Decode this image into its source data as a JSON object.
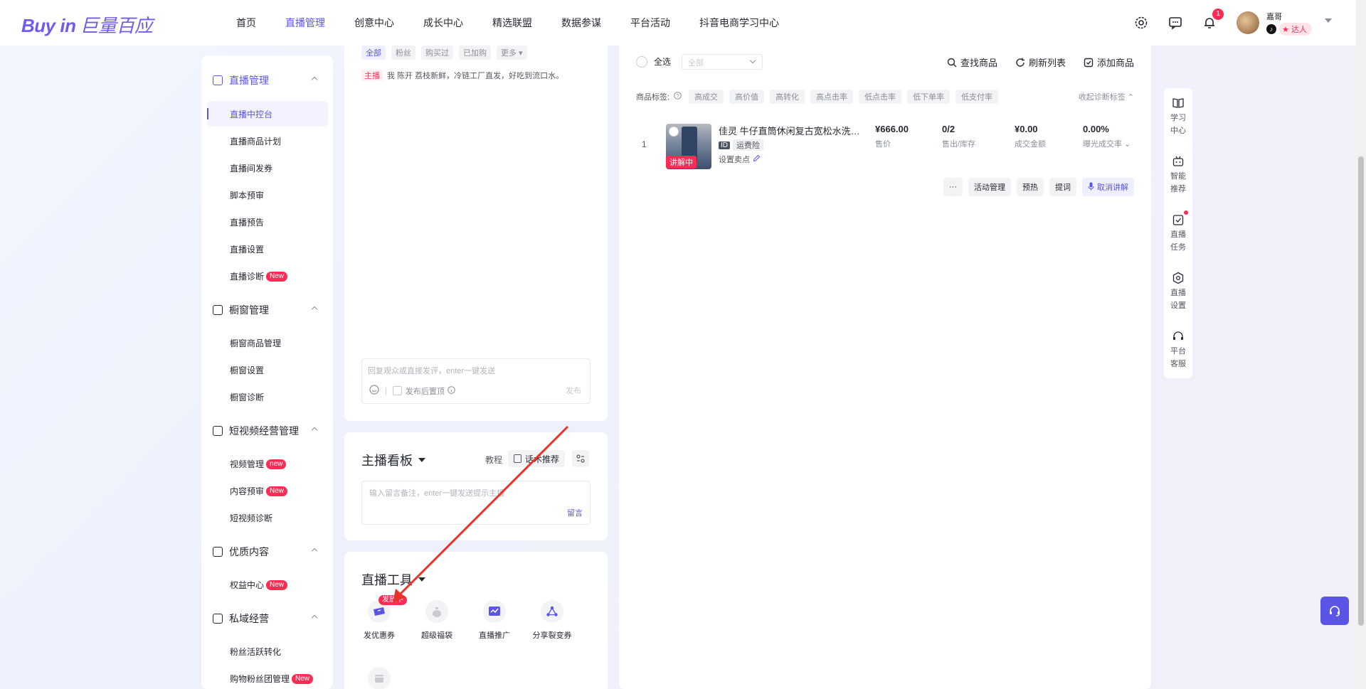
{
  "header": {
    "logo_en": "Buy in",
    "logo_cn": "巨量百应",
    "nav": [
      "首页",
      "直播管理",
      "创意中心",
      "成长中心",
      "精选联盟",
      "数据参谋",
      "平台活动",
      "抖音电商学习中心"
    ],
    "active_nav": "直播管理",
    "notification_count": "1",
    "user_name": "嘉哥",
    "user_tag": "达人",
    "douyin_glyph": "♪",
    "talent_glyph": "★"
  },
  "sidebar": {
    "groups": [
      {
        "label": "直播管理",
        "items": [
          "直播中控台",
          "直播商品计划",
          "直播间发券",
          "脚本预审",
          "直播预告",
          "直播设置",
          "直播诊断"
        ]
      },
      {
        "label": "橱窗管理",
        "items": [
          "橱窗商品管理",
          "橱窗设置",
          "橱窗诊断"
        ]
      },
      {
        "label": "短视频经营管理",
        "items": [
          "视频管理",
          "内容预审",
          "短视频诊断"
        ]
      },
      {
        "label": "优质内容",
        "items": [
          "权益中心"
        ]
      },
      {
        "label": "私域经营",
        "items": [
          "粉丝活跃转化",
          "购物粉丝团管理"
        ]
      }
    ],
    "badge_new": "New",
    "badge_new_lower": "new"
  },
  "chat": {
    "filters": [
      "全部",
      "粉丝",
      "购买过",
      "已加购",
      "更多 ▾"
    ],
    "host_tag": "主播",
    "message": "我 陈开 荔枝新鲜，冷链工厂直发，好吃到流口水。",
    "reply_placeholder": "回复观众或直接发评，enter一键发送",
    "pin_label": "发布后置顶",
    "send_label": "发布"
  },
  "board": {
    "title": "主播看板",
    "tutorial": "教程",
    "script_btn": "话术推荐",
    "note_placeholder": "输入留言备注，enter一键发送提示主播",
    "note_btn": "留言"
  },
  "tools": {
    "title": "直播工具",
    "items": [
      "发优惠券",
      "超级福袋",
      "直播推广",
      "分享裂变券"
    ],
    "issuing_badge": "发放中"
  },
  "products": {
    "select_all": "全选",
    "dropdown_placeholder": "全部",
    "actions": [
      "查找商品",
      "刷新列表",
      "添加商品"
    ],
    "tag_label": "商品标签:",
    "tags": [
      "高成交",
      "高价值",
      "高转化",
      "高点击率",
      "低点击率",
      "低下单率",
      "低支付率"
    ],
    "collapse_label": "收起诊断标签",
    "row": {
      "index": "1",
      "title": "佳灵 牛仔直筒休闲复古宽松水洗牛仔裤",
      "explain_badge": "讲解中",
      "id_tag": "ID",
      "insurance_tag": "运费险",
      "set_selling_point": "设置卖点",
      "price": "¥666.00",
      "price_label": "售价",
      "sold": "0/2",
      "sold_label": "售出/库存",
      "gmv": "¥0.00",
      "gmv_label": "成交金额",
      "rate": "0.00%",
      "rate_label": "曝光成交率 ⌄"
    },
    "ops": [
      "···",
      "活动管理",
      "预热",
      "提词",
      "取消讲解"
    ]
  },
  "rail": [
    "学习中心",
    "智能推荐",
    "直播任务",
    "直播设置",
    "平台客服"
  ],
  "colors": {
    "accent": "#5a55e6",
    "danger": "#fe2c55"
  }
}
